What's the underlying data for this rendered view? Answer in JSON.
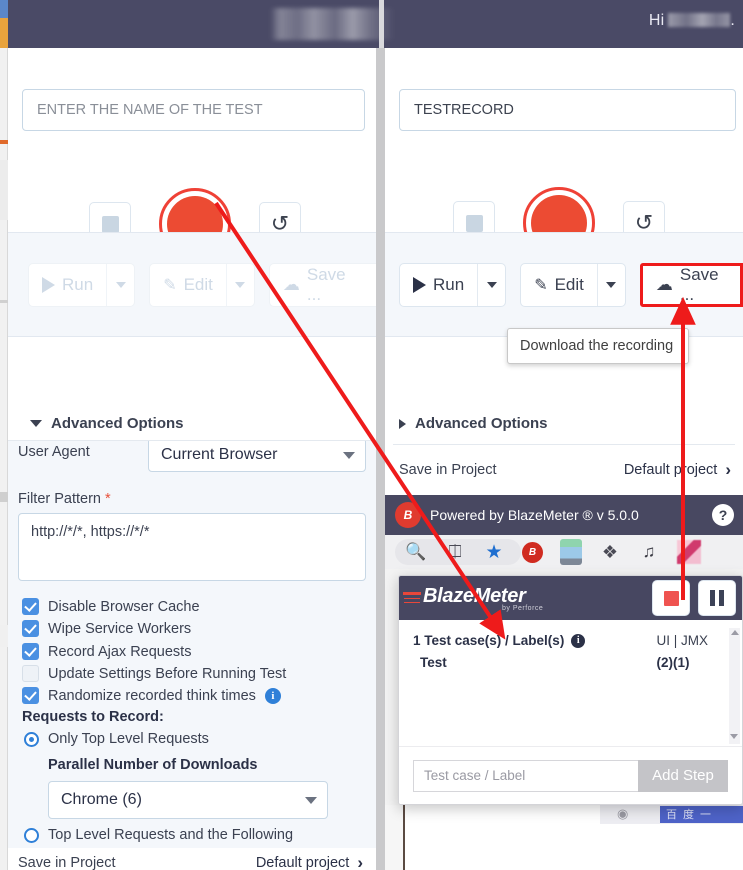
{
  "header": {
    "greeting": "Hi",
    "username_redacted": true,
    "title_redacted": true,
    "bg_color": "#4a4a66"
  },
  "left_panel": {
    "test_name_placeholder": "ENTER THE NAME OF THE TEST",
    "test_name_value": "",
    "controls": {
      "stop_label": "stop",
      "record_label": "record",
      "reload_label": "reload",
      "reload_glyph": "↺"
    },
    "actions": {
      "run_label": "Run",
      "edit_label": "Edit",
      "save_label": "Save ...",
      "disabled": true
    },
    "advanced_options": {
      "title": "Advanced Options",
      "expanded": true,
      "user_agent_label": "User Agent",
      "user_agent_value": "Current Browser",
      "filter_pattern_label": "Filter Pattern",
      "filter_pattern_required": "*",
      "filter_pattern_value": "http://*/*, https://*/*",
      "checkboxes": [
        {
          "label": "Disable Browser Cache",
          "checked": true
        },
        {
          "label": "Wipe Service Workers",
          "checked": true
        },
        {
          "label": "Record Ajax Requests",
          "checked": true
        },
        {
          "label": "Update Settings Before Running Test",
          "checked": false
        },
        {
          "label": "Randomize recorded think times",
          "checked": true,
          "info": true
        }
      ],
      "requests_to_record_label": "Requests to Record:",
      "radios": [
        {
          "label": "Only Top Level Requests",
          "selected": true
        },
        {
          "label": "Top Level Requests and the Following",
          "selected": false
        }
      ],
      "parallel_downloads_label": "Parallel Number of Downloads",
      "parallel_downloads_value": "Chrome (6)"
    },
    "save_in_project_label": "Save in Project",
    "save_in_project_value": "Default project"
  },
  "right_panel": {
    "test_name_value": "TESTRECORD",
    "controls": {
      "stop_label": "stop",
      "record_label": "record",
      "reload_label": "reload",
      "reload_glyph": "↺"
    },
    "actions": {
      "run_label": "Run",
      "edit_label": "Edit",
      "save_label": "Save ...",
      "save_highlighted": true,
      "highlight_color": "#ee1b1b"
    },
    "tooltip_text": "Download the recording",
    "advanced_options": {
      "title": "Advanced Options",
      "expanded": false
    },
    "save_in_project_label": "Save in Project",
    "save_in_project_value": "Default project",
    "footer_bar": {
      "text": "Powered by BlazeMeter ® v 5.0.0",
      "help_label": "?",
      "logo_text": "B",
      "bg_color": "#484861"
    }
  },
  "browser_toolbar": {
    "icons": [
      "zoom-out-icon",
      "share-icon",
      "bookmark-star-icon",
      "blazemeter-extension-icon",
      "extension-block-icon",
      "puzzle-extension-icon",
      "playlist-icon",
      "pink-extension-icon"
    ]
  },
  "recording_popup": {
    "brand": "BlazeMeter",
    "byline": "by Perforce",
    "stop_button_label": "stop",
    "pause_button_label": "pause",
    "summary": "1 Test case(s) / Label(s)",
    "case_name": "Test",
    "col_header": "UI | JMX",
    "col_counts": "(2)(1)",
    "input_placeholder": "Test case / Label",
    "input_value": "",
    "add_step_label": "Add Step"
  },
  "page_background": {
    "cn_search_text": "百度一"
  },
  "annotations": {
    "arrow_color": "#ee1b1b",
    "arrow_1": "from record button (left panel) to recording popup",
    "arrow_2": "from recording popup area up to Save button (right panel)"
  }
}
